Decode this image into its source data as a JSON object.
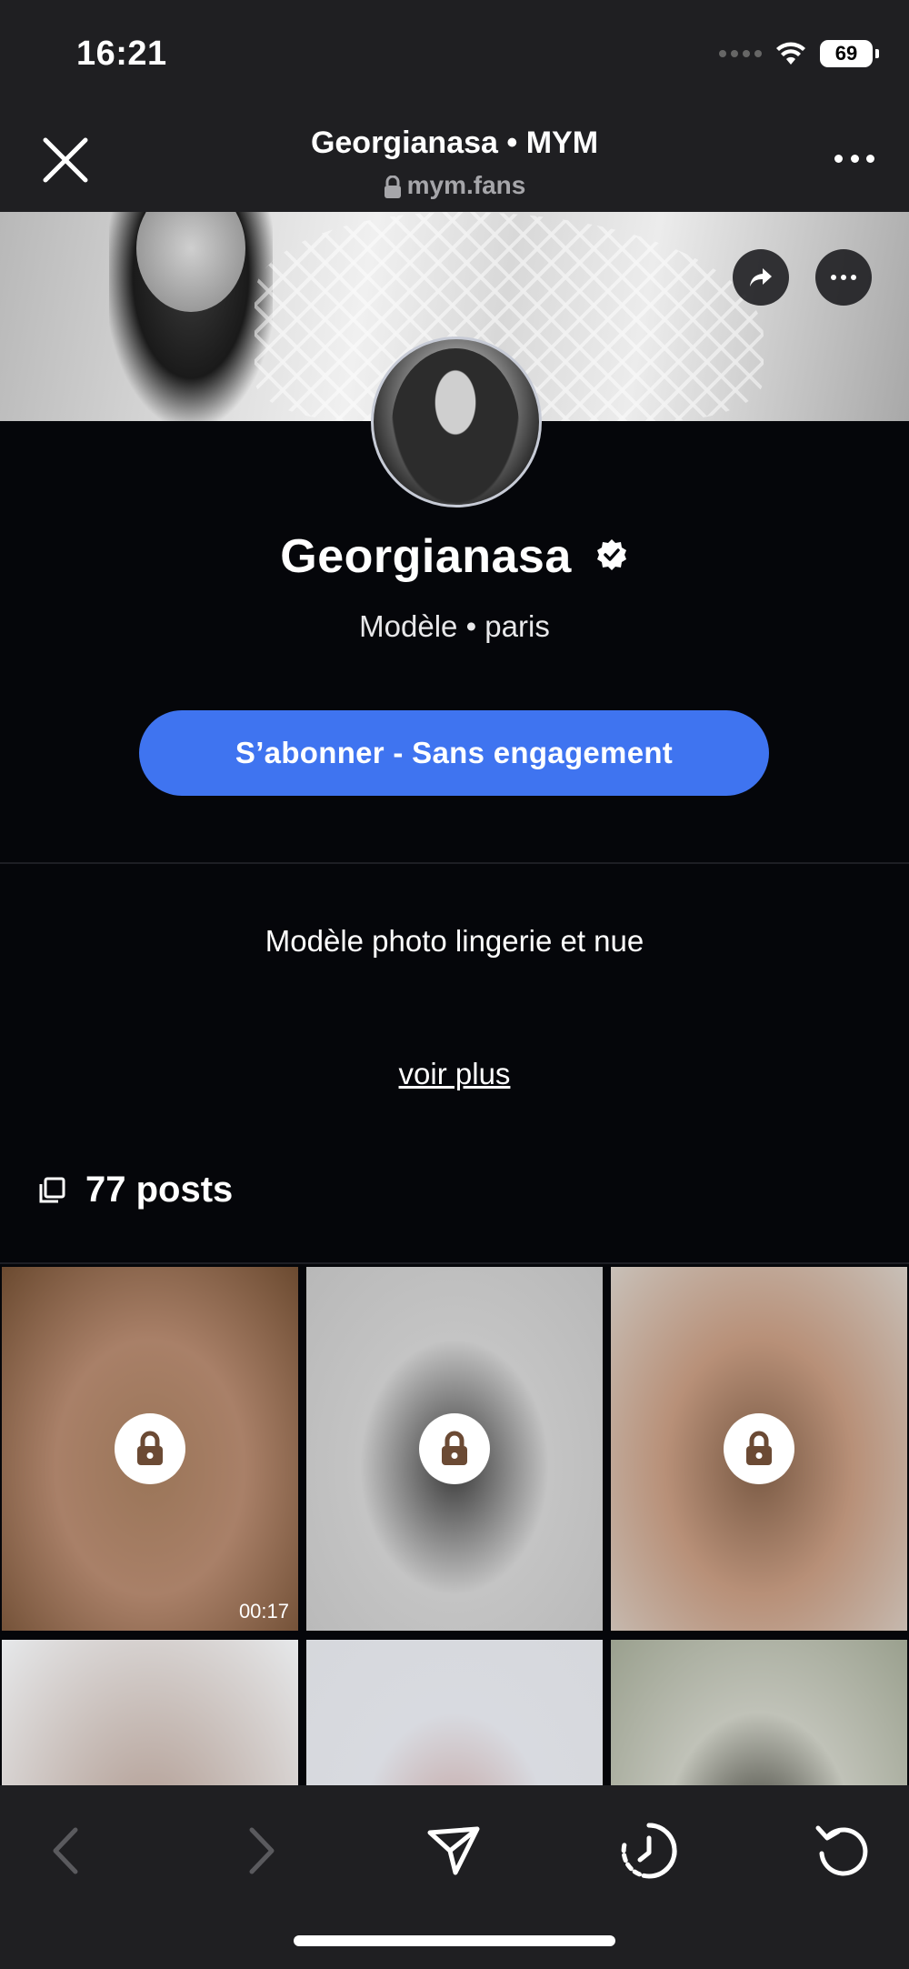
{
  "status_bar": {
    "time": "16:21",
    "battery": "69"
  },
  "nav": {
    "title": "Georgianasa • MYM",
    "url": "mym.fans"
  },
  "profile": {
    "name": "Georgianasa",
    "subtitle": "Modèle • paris",
    "subscribe_label": "S’abonner - Sans engagement",
    "bio": "Modèle photo lingerie et nue",
    "see_more": "voir plus",
    "posts_count": "77 posts"
  },
  "posts": [
    {
      "duration": "00:17",
      "locked": true,
      "colors": [
        "#6b4a30",
        "#9a7558",
        "#a98068"
      ]
    },
    {
      "duration": "",
      "locked": true,
      "colors": [
        "#b8b8b8",
        "#3a3a3a",
        "#c4c4c4"
      ]
    },
    {
      "duration": "",
      "locked": true,
      "colors": [
        "#c8c0b8",
        "#7a5a44",
        "#b89078"
      ]
    },
    {
      "duration": "",
      "locked": false,
      "colors": [
        "#e6e8ea",
        "#b09a90",
        "#c8bdb8"
      ]
    },
    {
      "duration": "",
      "locked": false,
      "colors": [
        "#d6d8dc",
        "#c2a2a0",
        "#d8dae0"
      ]
    },
    {
      "duration": "",
      "locked": false,
      "colors": [
        "#9aa08e",
        "#3a3a32",
        "#c0c2b8"
      ]
    }
  ],
  "colors": {
    "accent": "#3f74f0",
    "background": "#05060a",
    "bars": "#1f1f22"
  }
}
